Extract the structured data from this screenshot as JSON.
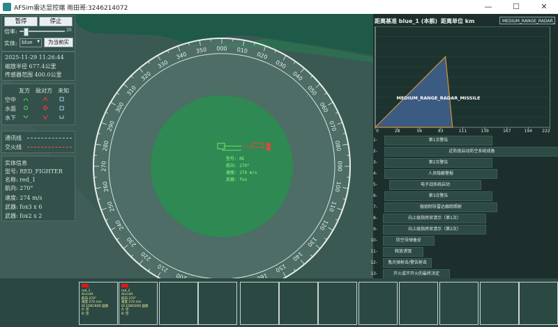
{
  "window": {
    "title": "AFSim雷达显控端 雨田哥:3246214072",
    "minimize": "—",
    "maximize": "☐",
    "close": "✕"
  },
  "controls": {
    "pause": "暂停",
    "stop": "停止",
    "rate_label": "倍率:",
    "rate_max": "20",
    "rate_value": 0.13,
    "entity_label": "实体:",
    "entity_value": "blue",
    "set_current": "为当前实"
  },
  "status": {
    "datetime": "2025-11-29 11:26:44",
    "zoom_radius": "缩放半径 677.4公里",
    "sensor_range": "传感器范围 400.0公里"
  },
  "legend": {
    "headers": [
      "友方",
      "敌对方",
      "未知"
    ],
    "rows": [
      "空中",
      "水面",
      "水下"
    ]
  },
  "lines": {
    "comm": "通讯线",
    "engage": "交火线"
  },
  "entity_info": {
    "title": "实体信息",
    "type": "型号: RED_FIGHTER",
    "name": "名称: red_1",
    "heading": "航向: 270°",
    "speed": "速度: 274 m/s",
    "weapon1": "武器: fox3 x 6",
    "weapon2": "武器: fox2 x 2"
  },
  "radar": {
    "bearing_labels": [
      "000",
      "010",
      "020",
      "030",
      "040",
      "050",
      "060",
      "070",
      "080",
      "090",
      "100",
      "110",
      "120",
      "130",
      "140",
      "150",
      "160",
      "170",
      "180",
      "190",
      "200",
      "210",
      "220",
      "230",
      "240",
      "250",
      "260",
      "270",
      "280",
      "290",
      "300",
      "310",
      "320",
      "330",
      "340",
      "350"
    ],
    "target_friend": "型号",
    "target_info": [
      "型号: RE",
      "航向: 270°",
      "速度: 274 m/s",
      "武器: fox"
    ]
  },
  "chart_header": {
    "reference": "距离基准 blue_1 (本舰)",
    "unit": "距离单位 km",
    "missile_tab": "MEDIUM_RANGE_RADAR_MISSILE"
  },
  "chart_data": {
    "type": "area",
    "series": [
      {
        "name": "MEDIUM_RANGE_RADAR_MISSILE",
        "x": [
          0,
          89,
          98,
          0
        ],
        "y": [
          0,
          700,
          0,
          0
        ]
      }
    ],
    "x_ticks": [
      "0",
      "28",
      "56",
      "83",
      "111",
      "139",
      "167",
      "194",
      "222"
    ],
    "y_ticks": [
      "0",
      "100",
      "200",
      "300",
      "400",
      "500",
      "600",
      "700",
      "800",
      "900",
      "1000"
    ],
    "xlim": [
      0,
      222
    ],
    "ylim": [
      0,
      1000
    ],
    "colors": {
      "fill": "#3c5b82",
      "stroke": "#d79538"
    }
  },
  "events": [
    {
      "n": "1-",
      "label": "第1次警告"
    },
    {
      "n": "2-",
      "label": "近防炮启动防空系统戒备"
    },
    {
      "n": "3-",
      "label": "第2次警告"
    },
    {
      "n": "4-",
      "label": "人员隐蔽警报"
    },
    {
      "n": "5-",
      "label": "电子战系统启动"
    },
    {
      "n": "6-",
      "label": "第3次警告"
    },
    {
      "n": "7-",
      "label": "舰炮制导雷达跟踪照射"
    },
    {
      "n": "8-",
      "label": "向上级指挥官请示（第1次）"
    },
    {
      "n": "9-",
      "label": "向上级指挥官请示（第2次）"
    },
    {
      "n": "10-",
      "label": "防空导弹备妥"
    },
    {
      "n": "11-",
      "label": "释放诱饵"
    },
    {
      "n": "12-",
      "label": "鬼光弹射击/警告射击"
    },
    {
      "n": "13-",
      "label": "开火或不开火的最终决定"
    }
  ],
  "cards": [
    {
      "lines": [
        "red_1",
        "Aircraft",
        "航向 270°",
        "速度 274 m/s",
        "ID 1D6C6D6 国旗",
        "A: 空",
        "B: 空"
      ]
    },
    {
      "lines": [
        "red_2",
        "Aircraft",
        "航向 270°",
        "速度 274 m/s",
        "ID 1D6D2D0 国旗",
        "A: 空",
        "B: 空"
      ]
    }
  ]
}
